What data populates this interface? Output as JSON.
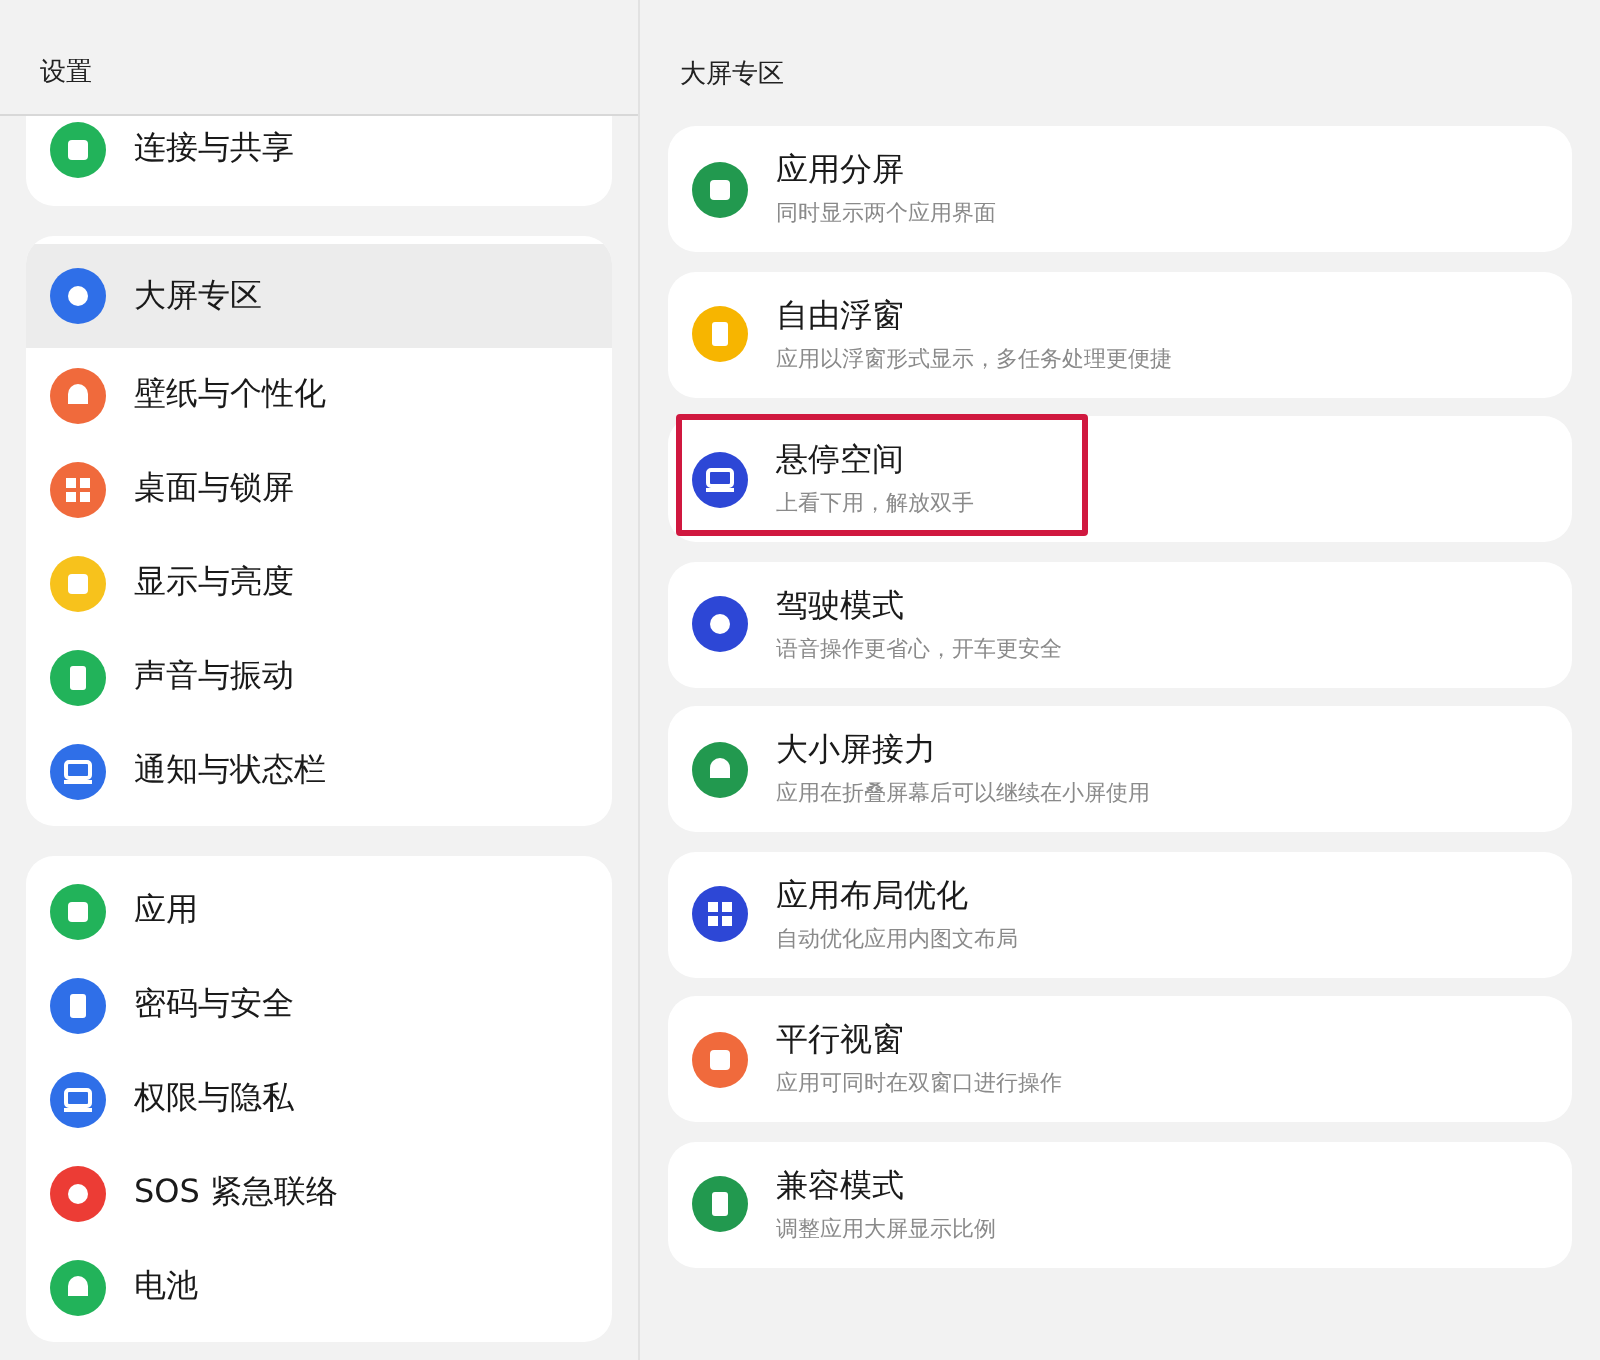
{
  "sidebar": {
    "title": "设置",
    "groups": [
      {
        "cut_top": true,
        "items": [
          {
            "label": "连接与共享",
            "color": "#22b35a",
            "selected": false
          }
        ]
      },
      {
        "cut_top": false,
        "items": [
          {
            "label": "大屏专区",
            "color": "#2f6fe8",
            "selected": true
          },
          {
            "label": "壁纸与个性化",
            "color": "#f06a3c",
            "selected": false
          },
          {
            "label": "桌面与锁屏",
            "color": "#f06a3c",
            "selected": false
          },
          {
            "label": "显示与亮度",
            "color": "#f7c21c",
            "selected": false
          },
          {
            "label": "声音与振动",
            "color": "#22b35a",
            "selected": false
          },
          {
            "label": "通知与状态栏",
            "color": "#2f6fe8",
            "selected": false
          }
        ]
      },
      {
        "cut_top": false,
        "items": [
          {
            "label": "应用",
            "color": "#22b35a",
            "selected": false
          },
          {
            "label": "密码与安全",
            "color": "#2f6fe8",
            "selected": false
          },
          {
            "label": "权限与隐私",
            "color": "#2f6fe8",
            "selected": false
          },
          {
            "label": "SOS 紧急联络",
            "color": "#ec3c35",
            "selected": false
          },
          {
            "label": "电池",
            "color": "#22b35a",
            "selected": false
          }
        ]
      }
    ]
  },
  "detail": {
    "title": "大屏专区",
    "items": [
      {
        "title": "应用分屏",
        "subtitle": "同时显示两个应用界面",
        "color": "#22994f",
        "highlighted": false
      },
      {
        "title": "自由浮窗",
        "subtitle": "应用以浮窗形式显示，多任务处理更便捷",
        "color": "#f7b500",
        "highlighted": false
      },
      {
        "title": "悬停空间",
        "subtitle": "上看下用，解放双手",
        "color": "#2d47d6",
        "highlighted": true
      },
      {
        "title": "驾驶模式",
        "subtitle": "语音操作更省心，开车更安全",
        "color": "#2d47d6",
        "highlighted": false
      },
      {
        "title": "大小屏接力",
        "subtitle": "应用在折叠屏幕后可以继续在小屏使用",
        "color": "#22994f",
        "highlighted": false
      },
      {
        "title": "应用布局优化",
        "subtitle": "自动优化应用内图文布局",
        "color": "#2d47d6",
        "highlighted": false
      },
      {
        "title": "平行视窗",
        "subtitle": "应用可同时在双窗口进行操作",
        "color": "#f06a3c",
        "highlighted": false
      },
      {
        "title": "兼容模式",
        "subtitle": "调整应用大屏显示比例",
        "color": "#22994f",
        "highlighted": false
      }
    ]
  }
}
